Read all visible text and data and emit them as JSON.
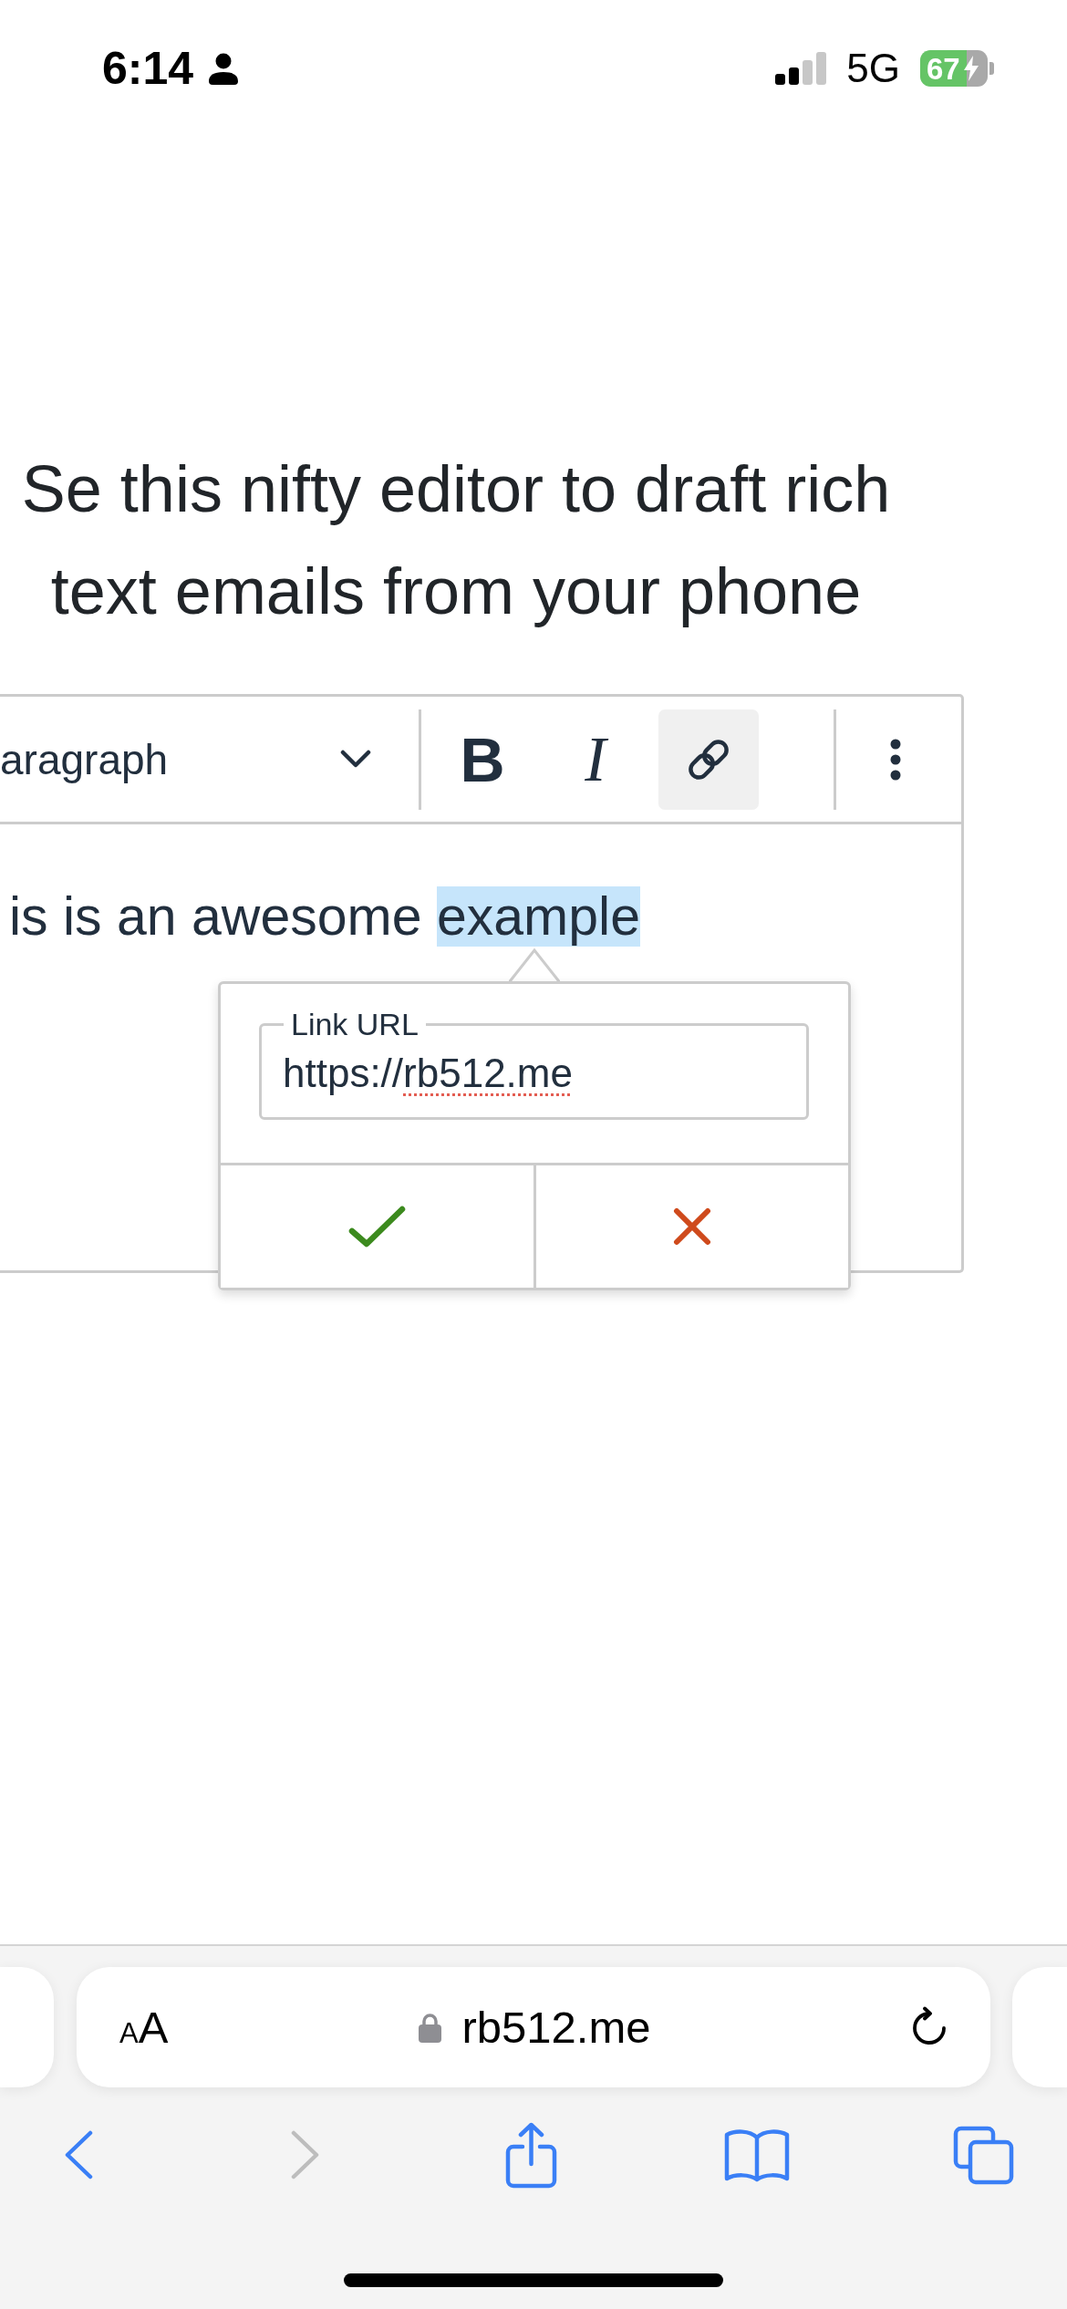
{
  "status_bar": {
    "time": "6:14",
    "network": "5G",
    "battery": "67",
    "charging": true
  },
  "heading": "Se this nifty editor to draft rich text emails from your phone",
  "editor": {
    "toolbar": {
      "format": "aragraph",
      "buttons": [
        {
          "kind": "bold",
          "label": "B",
          "selected": false
        },
        {
          "kind": "italic",
          "label": "I",
          "selected": false
        },
        {
          "kind": "link",
          "selected": true
        }
      ]
    },
    "content": [
      {
        "text": "is is an awesome",
        "selected": false
      },
      {
        "text": "example",
        "selected": true
      }
    ],
    "link_popup": {
      "field": {
        "label": "Link URL",
        "value": [
          {
            "text": "https://",
            "misspelled": false
          },
          {
            "text": "rb512.me",
            "misspelled": true
          }
        ]
      },
      "actions": [
        {
          "kind": "confirm"
        },
        {
          "kind": "cancel"
        }
      ]
    }
  },
  "browser": {
    "text_size": "AA",
    "secure": true,
    "address": "rb512.me",
    "toolbar": [
      {
        "kind": "back",
        "disabled": false
      },
      {
        "kind": "forward",
        "disabled": true
      },
      {
        "kind": "share",
        "disabled": false
      },
      {
        "kind": "bookmarks",
        "disabled": false
      },
      {
        "kind": "tabs",
        "disabled": false
      }
    ]
  }
}
